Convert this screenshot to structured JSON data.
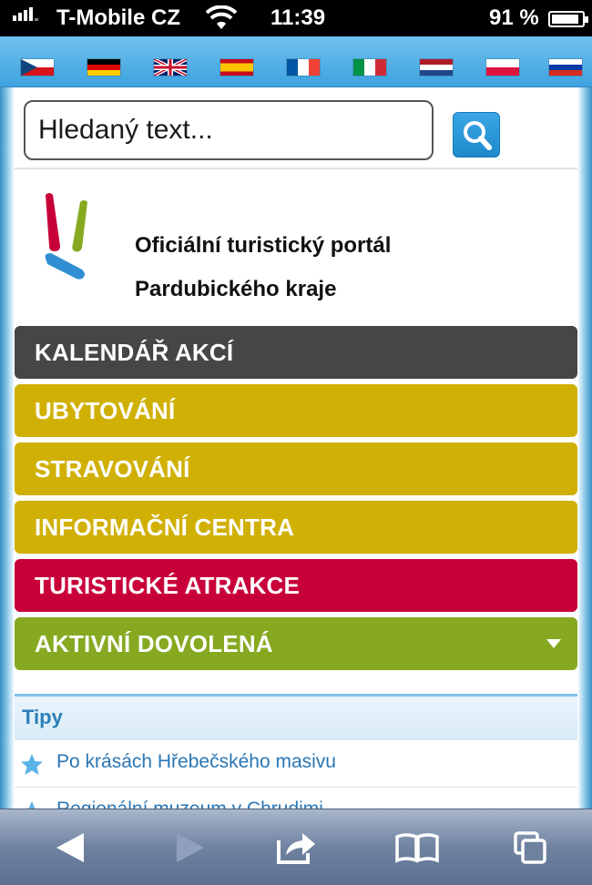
{
  "status_bar": {
    "carrier": "T-Mobile CZ",
    "time": "11:39",
    "battery": "91 %",
    "battery_level": 0.91
  },
  "language_flags": [
    {
      "lang": "cs",
      "icon": "czech-flag-icon"
    },
    {
      "lang": "de",
      "icon": "german-flag-icon"
    },
    {
      "lang": "en",
      "icon": "uk-flag-icon"
    },
    {
      "lang": "es",
      "icon": "spanish-flag-icon"
    },
    {
      "lang": "fr",
      "icon": "french-flag-icon"
    },
    {
      "lang": "it",
      "icon": "italian-flag-icon"
    },
    {
      "lang": "nl",
      "icon": "dutch-flag-icon"
    },
    {
      "lang": "pl",
      "icon": "polish-flag-icon"
    },
    {
      "lang": "ru",
      "icon": "russian-flag-icon"
    }
  ],
  "search": {
    "placeholder": "Hledaný text...",
    "value": "",
    "button_icon": "search-icon"
  },
  "header": {
    "title_line1": "Oficiální turistický portál",
    "title_line2": "Pardubického kraje"
  },
  "menu": [
    {
      "label": "KALENDÁŘ AKCÍ",
      "color": "#464646"
    },
    {
      "label": "UBYTOVÁNÍ",
      "color": "#d1b005"
    },
    {
      "label": "STRAVOVÁNÍ",
      "color": "#d1b005"
    },
    {
      "label": "INFORMAČNÍ CENTRA",
      "color": "#d1b005"
    },
    {
      "label": "TURISTICKÉ ATRAKCE",
      "color": "#c8003a"
    },
    {
      "label": "AKTIVNÍ DOVOLENÁ",
      "color": "#86a921"
    }
  ],
  "tips": {
    "heading": "Tipy",
    "items": [
      "Po krásách Hřebečského masivu",
      "Regionální muzeum v Chrudimi"
    ]
  },
  "toolbar": {
    "back_icon": "back-arrow-icon",
    "forward_icon": "forward-arrow-icon",
    "share_icon": "share-icon",
    "bookmarks_icon": "bookmarks-book-icon",
    "tabs_icon": "tabs-icon"
  }
}
